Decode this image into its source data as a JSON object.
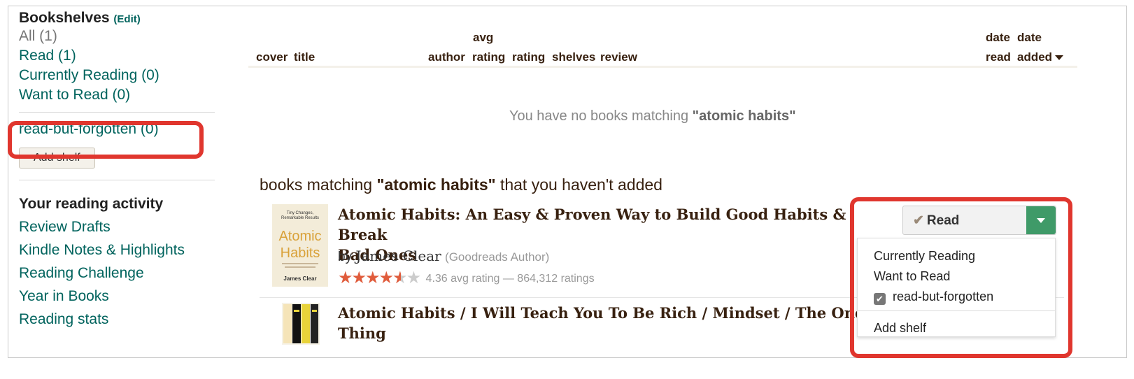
{
  "sidebar": {
    "title": "Bookshelves",
    "edit": "(Edit)",
    "shelves": [
      {
        "label": "All (1)"
      },
      {
        "label": "Read (1)"
      },
      {
        "label": "Currently Reading (0)"
      },
      {
        "label": "Want to Read (0)"
      }
    ],
    "custom_shelf": "read-but-forgotten (0)",
    "add_shelf": "Add shelf",
    "activity_title": "Your reading activity",
    "activity": [
      {
        "label": "Review Drafts"
      },
      {
        "label": "Kindle Notes & Highlights"
      },
      {
        "label": "Reading Challenge"
      },
      {
        "label": "Year in Books"
      },
      {
        "label": "Reading stats"
      }
    ]
  },
  "table_header": {
    "cover": "cover",
    "title": "title",
    "author": "author",
    "avg": "avg",
    "avg_rating": "rating",
    "rating": "rating",
    "shelves": "shelves",
    "review": "review",
    "date_read_1": "date",
    "date_read_2": "read",
    "date_added_1": "date",
    "date_added_2": "added"
  },
  "no_books": {
    "prefix": "You have no books matching ",
    "query": "\"atomic habits\""
  },
  "matching": {
    "prefix": "books matching ",
    "query": "\"atomic habits\"",
    "suffix": " that you haven't added"
  },
  "books": [
    {
      "title_line1": "Atomic Habits: An Easy & Proven Way to Build Good Habits & Break",
      "title_line2": "Bad Ones",
      "by": "by ",
      "author": "James Clear",
      "author_note": "(Goodreads Author)",
      "rating_text": "4.36 avg rating — 864,312 ratings",
      "stars": 4.36
    },
    {
      "title_line1": "Atomic Habits / I Will Teach You To Be Rich / Mindset / The One",
      "title_line2": "Thing"
    }
  ],
  "read_button": {
    "label": "Read"
  },
  "dropdown": {
    "items": [
      {
        "label": "Currently Reading"
      },
      {
        "label": "Want to Read"
      },
      {
        "label": "read-but-forgotten",
        "checked": true
      }
    ],
    "add_shelf": "Add shelf"
  },
  "colors": {
    "link": "#00635d",
    "highlight": "#e0362e",
    "button_green": "#3f9a68",
    "stars": "#e05c3c"
  }
}
